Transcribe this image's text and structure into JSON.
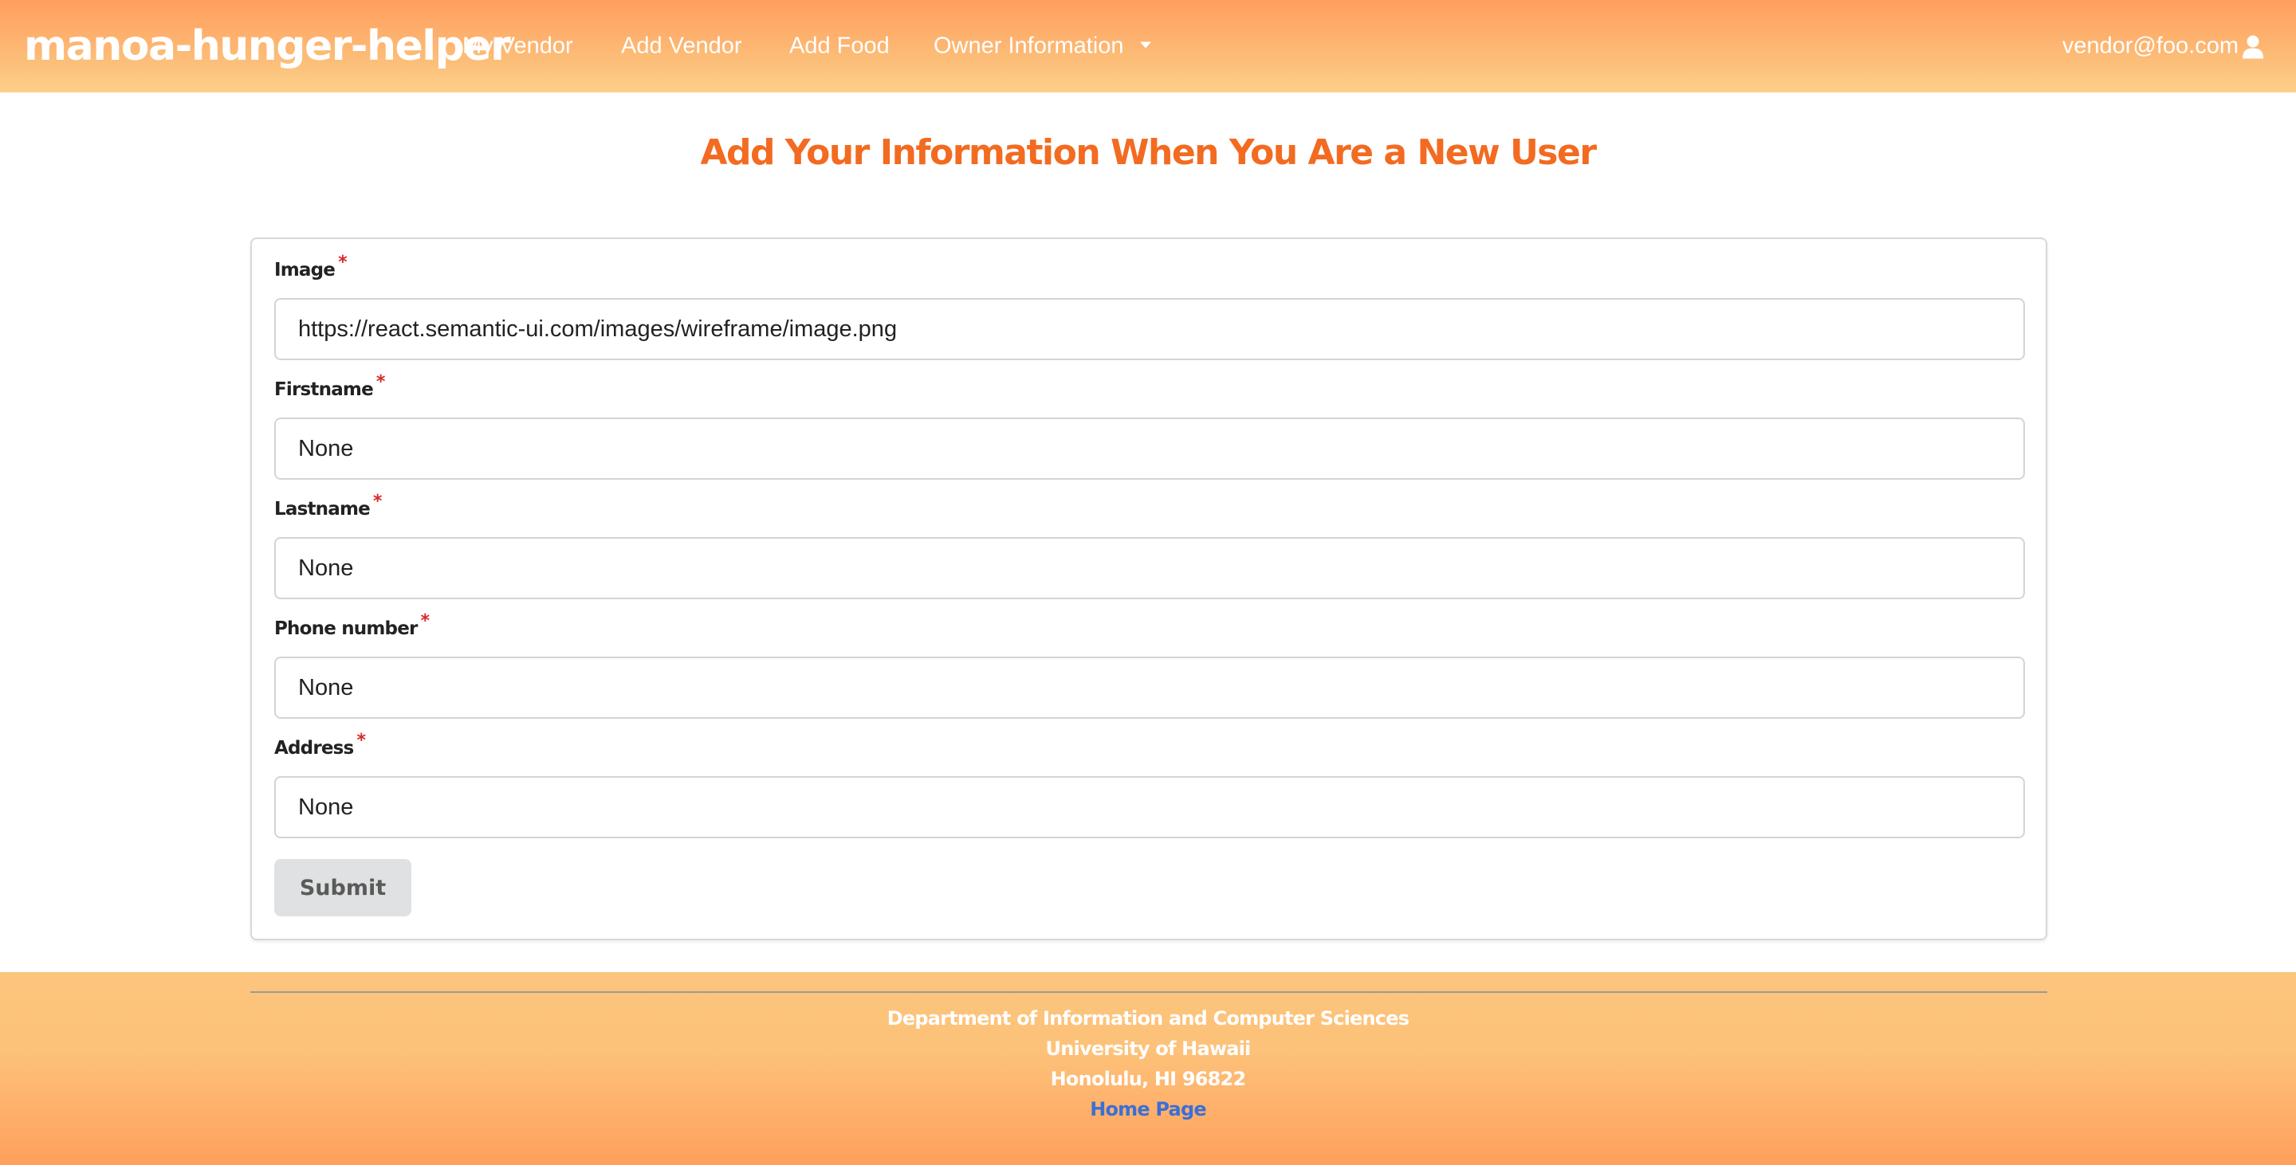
{
  "navbar": {
    "brand": "manoa-hunger-helper",
    "items": [
      {
        "label": "My Vendor"
      },
      {
        "label": "Add Vendor"
      },
      {
        "label": "Add Food"
      },
      {
        "label": "Owner Information"
      }
    ],
    "user_email": "vendor@foo.com",
    "user_icon": "user-icon",
    "dropdown_icon": "caret-down-icon",
    "background_colors": [
      "#ff9e5e",
      "#fdd08a"
    ]
  },
  "page": {
    "title": "Add Your Information When You Are a New User",
    "title_color": "#f26b21"
  },
  "form": {
    "required_marker": "*",
    "fields": [
      {
        "label": "Image",
        "value": "https://react.semantic-ui.com/images/wireframe/image.png",
        "required": true
      },
      {
        "label": "Firstname",
        "value": "None",
        "required": true
      },
      {
        "label": "Lastname",
        "value": "None",
        "required": true
      },
      {
        "label": "Phone number",
        "value": "None",
        "required": true
      },
      {
        "label": "Address",
        "value": "None",
        "required": true
      }
    ],
    "submit_label": "Submit"
  },
  "footer": {
    "lines": [
      "Department of Information and Computer Sciences",
      "University of Hawaii",
      "Honolulu, HI 96822"
    ],
    "link_label": "Home Page",
    "link_color": "#3b6fd6"
  }
}
